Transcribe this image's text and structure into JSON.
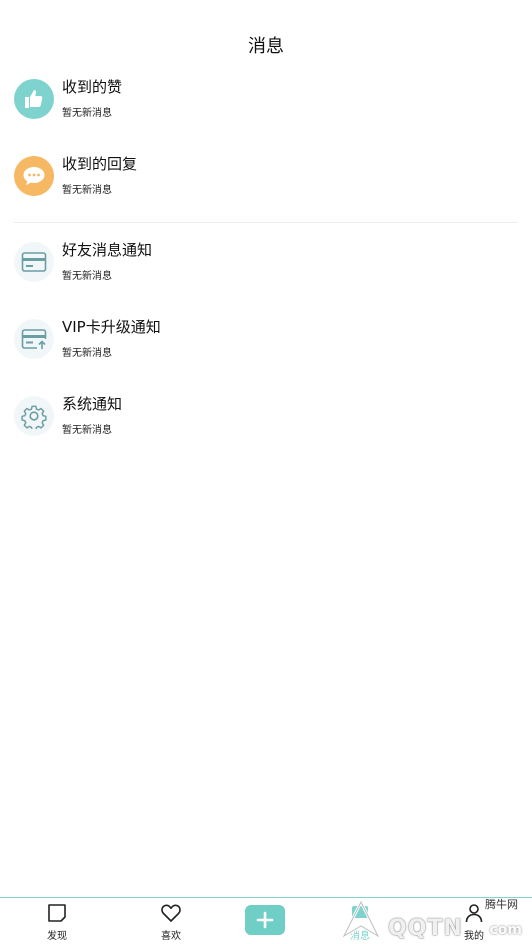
{
  "header": {
    "title": "消息"
  },
  "messages": [
    {
      "title": "收到的赞",
      "subtitle": "暂无新消息",
      "icon": "thumbs-up-icon",
      "color": "#7fd3cf"
    },
    {
      "title": "收到的回复",
      "subtitle": "暂无新消息",
      "icon": "chat-bubble-icon",
      "color": "#f6b862"
    },
    {
      "title": "好友消息通知",
      "subtitle": "暂无新消息",
      "icon": "card-icon"
    },
    {
      "title": "VIP卡升级通知",
      "subtitle": "暂无新消息",
      "icon": "card-upgrade-icon"
    },
    {
      "title": "系统通知",
      "subtitle": "暂无新消息",
      "icon": "gear-icon"
    }
  ],
  "tabbar": {
    "tabs": [
      {
        "label": "发现",
        "icon": "square-icon"
      },
      {
        "label": "喜欢",
        "icon": "heart-icon"
      },
      {
        "label": "",
        "icon": "plus-icon"
      },
      {
        "label": "消息",
        "icon": "message-icon",
        "active": true
      },
      {
        "label": "我的",
        "icon": "person-icon"
      }
    ]
  },
  "watermark": {
    "brand": "QQTN",
    "suffix": "com",
    "small": "腾牛网"
  },
  "colors": {
    "accent": "#7fd3cf",
    "orange": "#f6b862",
    "divider": "#ececec"
  }
}
